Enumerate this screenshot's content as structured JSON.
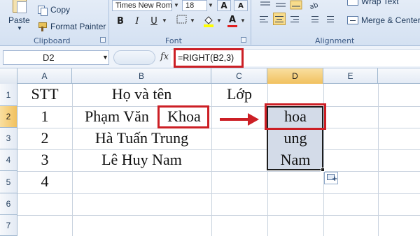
{
  "ribbon": {
    "clipboard": {
      "paste_label": "Paste",
      "copy_label": "Copy",
      "format_painter_label": "Format Painter",
      "group_label": "Clipboard"
    },
    "font": {
      "font_name": "Times New Rom",
      "font_size": "18",
      "grow_label": "A",
      "shrink_label": "A",
      "bold_label": "B",
      "italic_label": "I",
      "underline_label": "U",
      "font_color_label": "A",
      "group_label": "Font"
    },
    "alignment": {
      "wrap_text_label": "Wrap Text",
      "merge_center_label": "Merge & Center",
      "group_label": "Alignment"
    }
  },
  "formula_bar": {
    "name_box": "D2",
    "fx_label": "fx",
    "formula": "=RIGHT(B2,3)"
  },
  "columns": [
    "A",
    "B",
    "C",
    "D",
    "E"
  ],
  "active_column": "D",
  "rows": [
    "1",
    "2",
    "3",
    "4",
    "5",
    "6",
    "7"
  ],
  "active_row": "2",
  "cells": {
    "A1": "STT",
    "B1": "Họ và tên",
    "C1": "Lớp",
    "A2": "1",
    "B2_prefix": "Phạm Văn",
    "B2_highlight": "Khoa",
    "D2": "hoa",
    "A3": "2",
    "B3": "Hà Tuấn Trung",
    "D3": "ung",
    "A4": "3",
    "B4": "Lê Huy Nam",
    "D4": "Nam",
    "A5": "4"
  },
  "colors": {
    "highlight_red": "#cc1f25",
    "selection_fill": "#d3dbe8",
    "active_header": "#f1c15f"
  }
}
